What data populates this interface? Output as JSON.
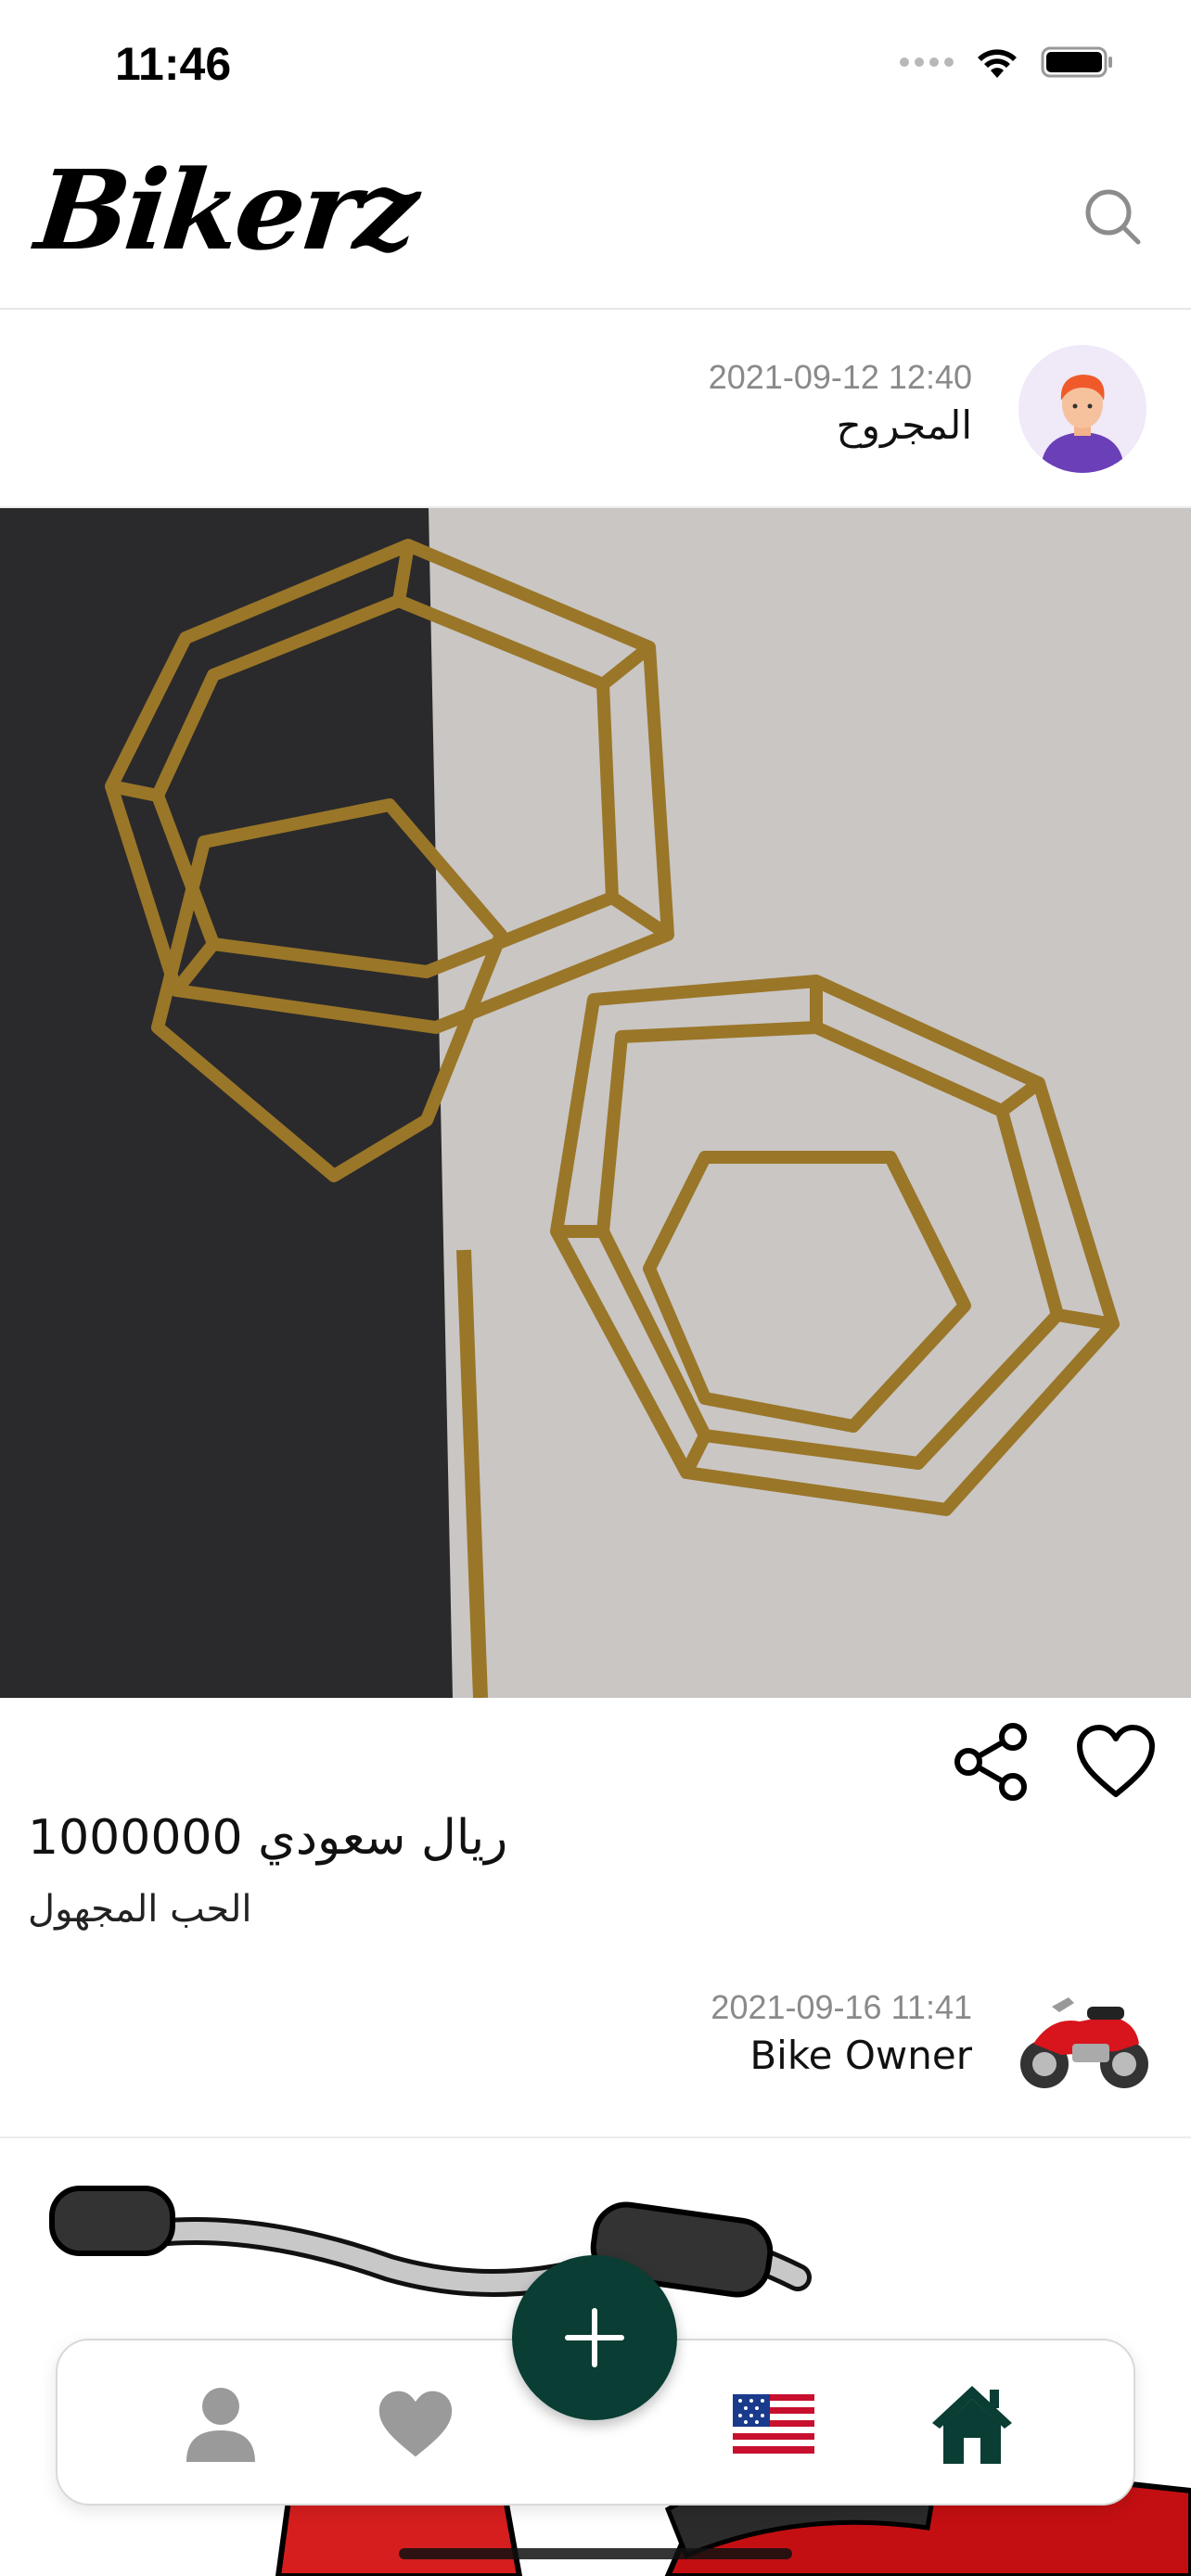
{
  "status_bar": {
    "time": "11:46"
  },
  "header": {
    "logo": "Bikerz",
    "search_icon": "search-icon"
  },
  "posts": [
    {
      "date": "2021-09-12 12:40",
      "author": "المجروح",
      "price": "1000000 ريال سعودي",
      "title": "الحب المجهول",
      "avatar_icon": "person-avatar-icon"
    },
    {
      "date": "2021-09-16 11:41",
      "author": "Bike Owner",
      "avatar_icon": "motorcycle-avatar-icon"
    }
  ],
  "bottom_nav": {
    "items": [
      "profile-icon",
      "heart-icon",
      "add-icon",
      "us-flag-icon",
      "home-icon"
    ],
    "active": "home"
  },
  "colors": {
    "accent": "#0a3d33",
    "inactive_icon": "#9a9a9a",
    "date_text": "#8a8a8a"
  }
}
